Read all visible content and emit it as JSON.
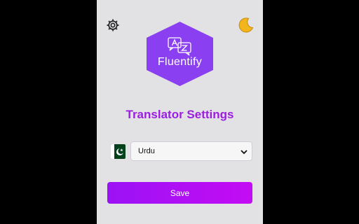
{
  "app": {
    "logo_text": "Fluentify",
    "title": "Translator Settings"
  },
  "icons": {
    "settings": "gear-icon",
    "theme_toggle": "moon-icon",
    "flag": "pakistan-flag-icon",
    "translate": "translate-icon"
  },
  "language_select": {
    "selected": "Urdu"
  },
  "actions": {
    "save_label": "Save"
  },
  "colors": {
    "panel_background": "#e2e1e4",
    "page_background": "#000000",
    "accent_purple": "#9b1ee0",
    "logo_hexagon": "#8a3ff0",
    "button_gradient_start": "#9b12f5",
    "button_gradient_end": "#c40cf4",
    "moon": "#f2b51c",
    "flag_green": "#01411c"
  }
}
